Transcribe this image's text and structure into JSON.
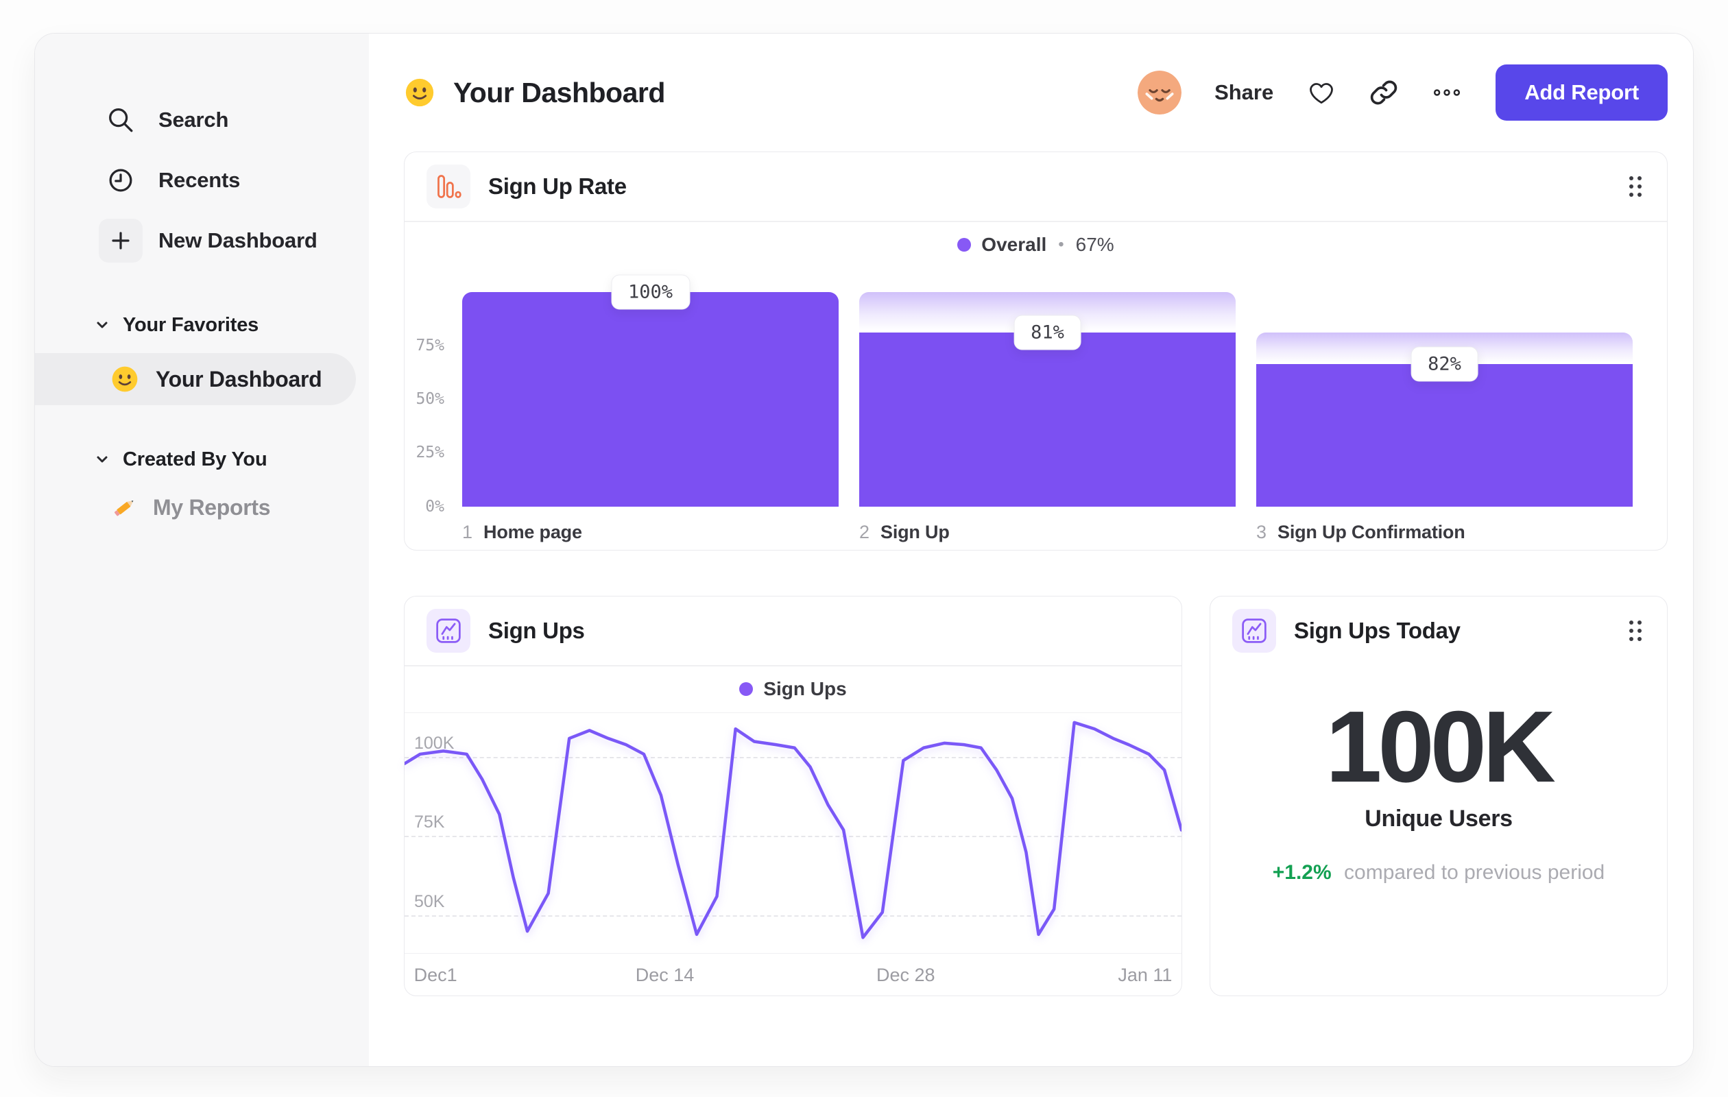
{
  "colors": {
    "accent_purple": "#7C50F2",
    "line_purple": "#7A58F7",
    "legend_dot_purple": "#8759F5",
    "button_purple": "#5847EA",
    "funnel_icon_orange": "#F0734B",
    "chart_icon_purple": "#8B5CF6",
    "positive_green": "#13A052",
    "avatar_peach": "#F4A97E",
    "sidebar_bg": "#F7F7F8"
  },
  "sidebar": {
    "items": [
      {
        "icon": "search-icon",
        "label": "Search"
      },
      {
        "icon": "clock-icon",
        "label": "Recents"
      },
      {
        "icon": "plus-icon",
        "label": "New Dashboard"
      }
    ],
    "sections": [
      {
        "label": "Your Favorites",
        "items": [
          {
            "emoji": "smiley",
            "label": "Your Dashboard",
            "selected": true
          }
        ]
      },
      {
        "label": "Created By You",
        "items": [
          {
            "emoji": "pencil",
            "label": "My Reports",
            "selected": false
          }
        ]
      }
    ]
  },
  "header": {
    "title": "Your Dashboard",
    "share_label": "Share",
    "add_report_label": "Add Report"
  },
  "cards": {
    "signup_rate": {
      "title": "Sign Up Rate",
      "legend": {
        "label": "Overall",
        "separator": "•",
        "value": "67%"
      },
      "steps": [
        {
          "index": "1",
          "label": "Home page",
          "value_label": "100%"
        },
        {
          "index": "2",
          "label": "Sign Up",
          "value_label": "81%"
        },
        {
          "index": "3",
          "label": "Sign Up Confirmation",
          "value_label": "82%"
        }
      ]
    },
    "sign_ups": {
      "title": "Sign Ups",
      "legend_label": "Sign Ups"
    },
    "sign_ups_today": {
      "title": "Sign Ups Today",
      "value": "100K",
      "label": "Unique Users",
      "delta": "+1.2%",
      "delta_note": "compared to previous period"
    }
  },
  "chart_data": [
    {
      "type": "bar",
      "title": "Sign Up Rate",
      "subtitle_legend": "Overall • 67%",
      "categories": [
        "Home page",
        "Sign Up",
        "Sign Up Confirmation"
      ],
      "values": [
        100,
        81,
        82
      ],
      "value_labels": [
        "100%",
        "81%",
        "82%"
      ],
      "cumulative_pct": [
        100,
        81,
        66.4
      ],
      "overall_conversion_pct": 67,
      "ylabel": "%",
      "ylim": [
        0,
        100
      ],
      "yticks": [
        {
          "v": 75,
          "label": "75%"
        },
        {
          "v": 50,
          "label": "50%"
        },
        {
          "v": 25,
          "label": "25%"
        },
        {
          "v": 0,
          "label": "0%"
        }
      ],
      "grid": false,
      "legend_position": "top-center"
    },
    {
      "type": "line",
      "title": "Sign Ups",
      "unit": "K users",
      "ylim": [
        38,
        114
      ],
      "yticks": [
        {
          "v": 100,
          "label": "100K"
        },
        {
          "v": 75,
          "label": "75K"
        },
        {
          "v": 50,
          "label": "50K"
        }
      ],
      "x_ticks": [
        {
          "pos": 0.012,
          "label": "Dec1",
          "align": "left"
        },
        {
          "pos": 0.335,
          "label": "Dec 14",
          "align": "center"
        },
        {
          "pos": 0.645,
          "label": "Dec 28",
          "align": "center"
        },
        {
          "pos": 0.988,
          "label": "Jan 11",
          "align": "right"
        }
      ],
      "grid": "dashed-horizontal",
      "legend_position": "top-center",
      "series": [
        {
          "name": "Sign Ups",
          "color": "#7A58F7",
          "points": [
            [
              0.0,
              98
            ],
            [
              0.02,
              101
            ],
            [
              0.05,
              102
            ],
            [
              0.08,
              101
            ],
            [
              0.1,
              93
            ],
            [
              0.122,
              82
            ],
            [
              0.14,
              62
            ],
            [
              0.158,
              45
            ],
            [
              0.185,
              57
            ],
            [
              0.212,
              106
            ],
            [
              0.238,
              108.5
            ],
            [
              0.262,
              106
            ],
            [
              0.285,
              104
            ],
            [
              0.308,
              101
            ],
            [
              0.33,
              88
            ],
            [
              0.352,
              66
            ],
            [
              0.376,
              44
            ],
            [
              0.402,
              56
            ],
            [
              0.426,
              109
            ],
            [
              0.45,
              105
            ],
            [
              0.478,
              104
            ],
            [
              0.502,
              103
            ],
            [
              0.522,
              97
            ],
            [
              0.545,
              85
            ],
            [
              0.565,
              77
            ],
            [
              0.59,
              43
            ],
            [
              0.615,
              51
            ],
            [
              0.642,
              99
            ],
            [
              0.668,
              103
            ],
            [
              0.695,
              104.5
            ],
            [
              0.72,
              104
            ],
            [
              0.742,
              103
            ],
            [
              0.762,
              96
            ],
            [
              0.782,
              87
            ],
            [
              0.8,
              70
            ],
            [
              0.816,
              44
            ],
            [
              0.836,
              52
            ],
            [
              0.862,
              111
            ],
            [
              0.888,
              109
            ],
            [
              0.912,
              106
            ],
            [
              0.932,
              104
            ],
            [
              0.958,
              101
            ],
            [
              0.978,
              96
            ],
            [
              1.0,
              77
            ]
          ]
        }
      ]
    }
  ]
}
